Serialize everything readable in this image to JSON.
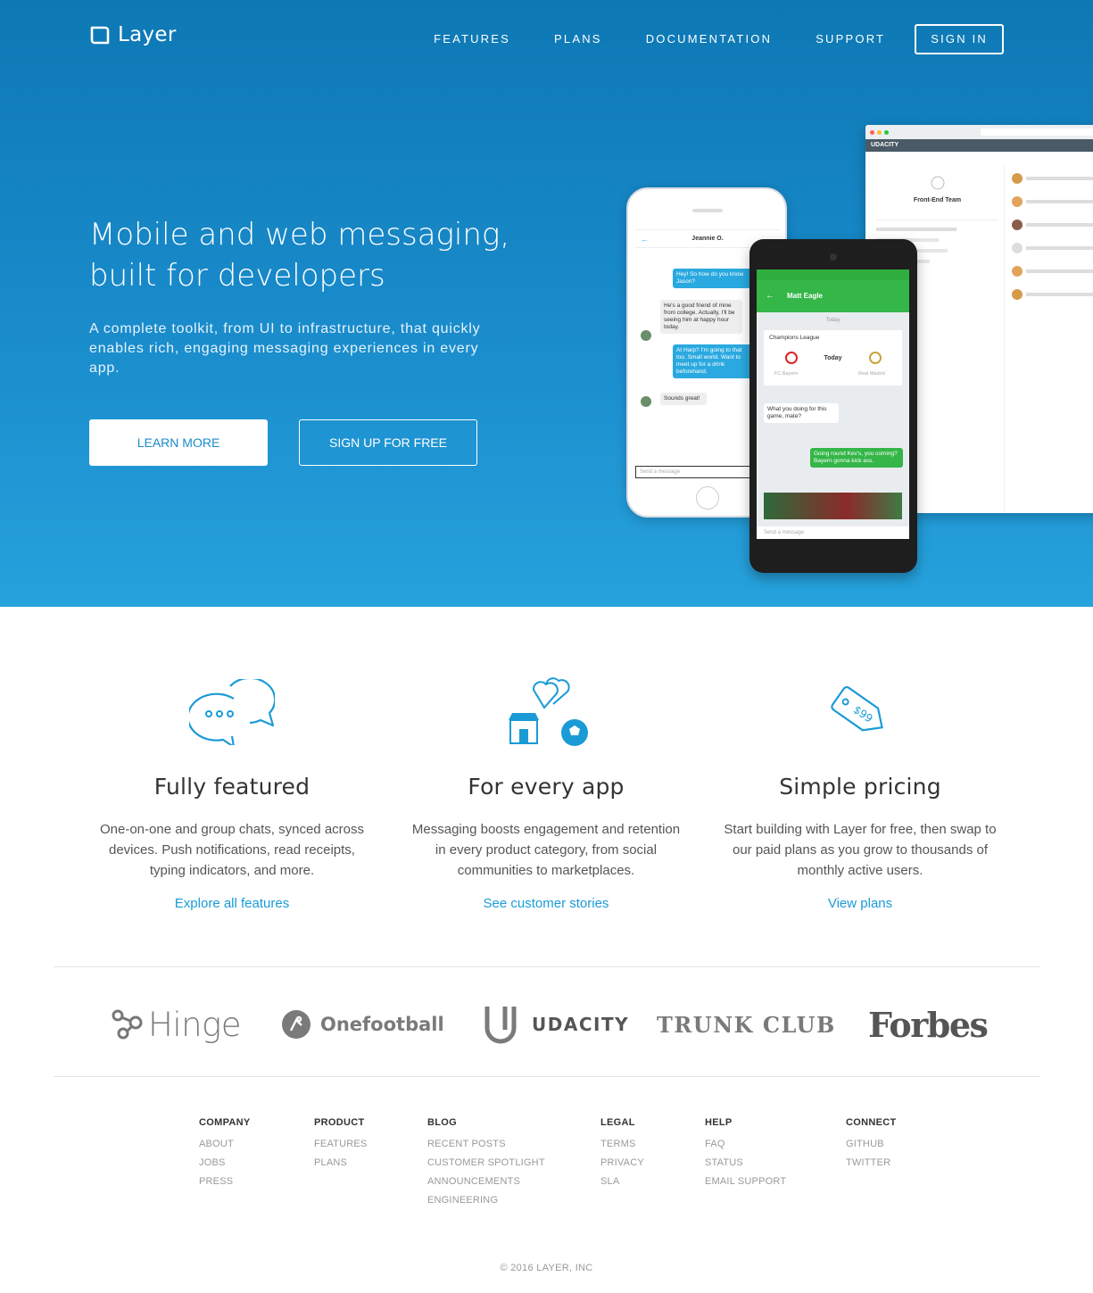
{
  "brand": {
    "name": "Layer"
  },
  "nav": {
    "items": [
      "FEATURES",
      "PLANS",
      "DOCUMENTATION",
      "SUPPORT"
    ],
    "signin": "SIGN IN"
  },
  "hero": {
    "title_line1": "Mobile and web messaging,",
    "title_line2": "built for developers",
    "subtitle": "A complete toolkit, from UI to infrastructure, that quickly enables rich, engaging messaging experiences in every app.",
    "learn_more": "LEARN MORE",
    "signup": "SIGN UP FOR FREE"
  },
  "mockups": {
    "desktop_header": "UDACITY",
    "desktop_team": "Front-End Team",
    "iphone_contact": "Jeannie O.",
    "iphone_messages": [
      "Hey! So how do you know Jason?",
      "He's a good friend of mine from college. Actually, I'll be seeing him at happy hour today.",
      "At Harp? I'm going to that too. Small world. Want to meet up for a drink beforehand.",
      "Sounds great!"
    ],
    "iphone_input": "Send a message",
    "android_contact": "Matt Eagle",
    "android_day": "Today",
    "android_card_title": "Champions League",
    "android_card_time": "Today",
    "android_team_a": "FC Bayern",
    "android_team_b": "Real Madrid",
    "android_msg1": "What you doing for this game, mate?",
    "android_msg2": "Going round Kev's, you coming? Bayern gonna kick ass.",
    "android_input": "Send a message"
  },
  "features": [
    {
      "title": "Fully featured",
      "body": "One-on-one and group chats, synced across devices. Push notifications, read receipts, typing indicators, and more.",
      "link": "Explore all features"
    },
    {
      "title": "For every app",
      "body": "Messaging boosts engagement and retention in every product category, from social communities to marketplaces.",
      "link": "See customer stories"
    },
    {
      "title": "Simple pricing",
      "body": "Start building with Layer for free, then swap to our paid plans as you grow to thousands of monthly active users.",
      "link": "View plans"
    }
  ],
  "customers": [
    "Hinge",
    "Onefootball",
    "UDACITY",
    "TRUNK CLUB",
    "Forbes"
  ],
  "price_tag": "$99",
  "footer": {
    "columns": [
      {
        "heading": "COMPANY",
        "links": [
          "ABOUT",
          "JOBS",
          "PRESS"
        ]
      },
      {
        "heading": "PRODUCT",
        "links": [
          "FEATURES",
          "PLANS"
        ]
      },
      {
        "heading": "BLOG",
        "links": [
          "RECENT POSTS",
          "CUSTOMER SPOTLIGHT",
          "ANNOUNCEMENTS",
          "ENGINEERING"
        ]
      },
      {
        "heading": "LEGAL",
        "links": [
          "TERMS",
          "PRIVACY",
          "SLA"
        ]
      },
      {
        "heading": "HELP",
        "links": [
          "FAQ",
          "STATUS",
          "EMAIL SUPPORT"
        ]
      },
      {
        "heading": "CONNECT",
        "links": [
          "GITHUB",
          "TWITTER"
        ]
      }
    ],
    "copyright": "© 2016 LAYER, INC"
  },
  "colors": {
    "hero_top": "#0d78b4",
    "hero_bottom": "#26a2dc",
    "accent": "#1a9bd6",
    "android_green": "#34b648"
  }
}
